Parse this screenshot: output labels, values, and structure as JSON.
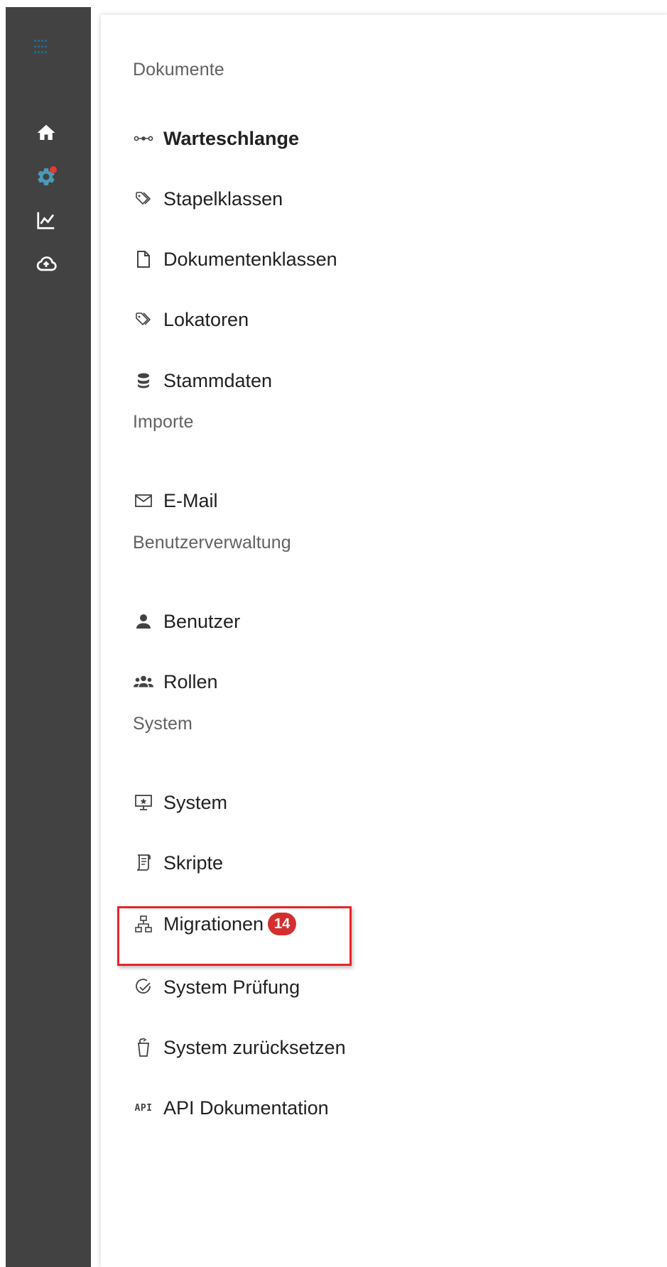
{
  "rail": {
    "icons": [
      {
        "name": "home-icon",
        "color": "#ffffff"
      },
      {
        "name": "settings-icon",
        "color": "#4a9ab8",
        "notification": true,
        "notification_color": "#e53935"
      },
      {
        "name": "chart-line-icon",
        "color": "#ffffff"
      },
      {
        "name": "cloud-upload-icon",
        "color": "#ffffff"
      }
    ]
  },
  "menu": {
    "sections": [
      {
        "header": "Dokumente",
        "items": [
          {
            "label": "Warteschlange",
            "icon": "queue-icon",
            "active": true
          },
          {
            "label": "Stapelklassen",
            "icon": "tags-icon"
          },
          {
            "label": "Dokumentenklassen",
            "icon": "document-icon"
          },
          {
            "label": "Lokatoren",
            "icon": "tags-icon"
          },
          {
            "label": "Stammdaten",
            "icon": "database-icon"
          }
        ]
      },
      {
        "header": "Importe",
        "items": [
          {
            "label": "E-Mail",
            "icon": "mail-icon"
          }
        ]
      },
      {
        "header": "Benutzerverwaltung",
        "items": [
          {
            "label": "Benutzer",
            "icon": "user-icon"
          },
          {
            "label": "Rollen",
            "icon": "users-icon"
          }
        ]
      },
      {
        "header": "System",
        "items": [
          {
            "label": "System",
            "icon": "monitor-icon"
          },
          {
            "label": "Skripte",
            "icon": "script-icon"
          },
          {
            "label": "Migrationen",
            "icon": "sitemap-icon",
            "badge": "14",
            "highlighted": true
          },
          {
            "label": "System Prüfung",
            "icon": "check-circle-icon"
          },
          {
            "label": "System zurücksetzen",
            "icon": "reset-icon"
          },
          {
            "label": "API Dokumentation",
            "icon": "api-icon",
            "icon_text": "API"
          }
        ]
      }
    ]
  },
  "colors": {
    "rail_background": "#424242",
    "badge_background": "#d32f2f",
    "highlight_border": "#e8242c"
  }
}
